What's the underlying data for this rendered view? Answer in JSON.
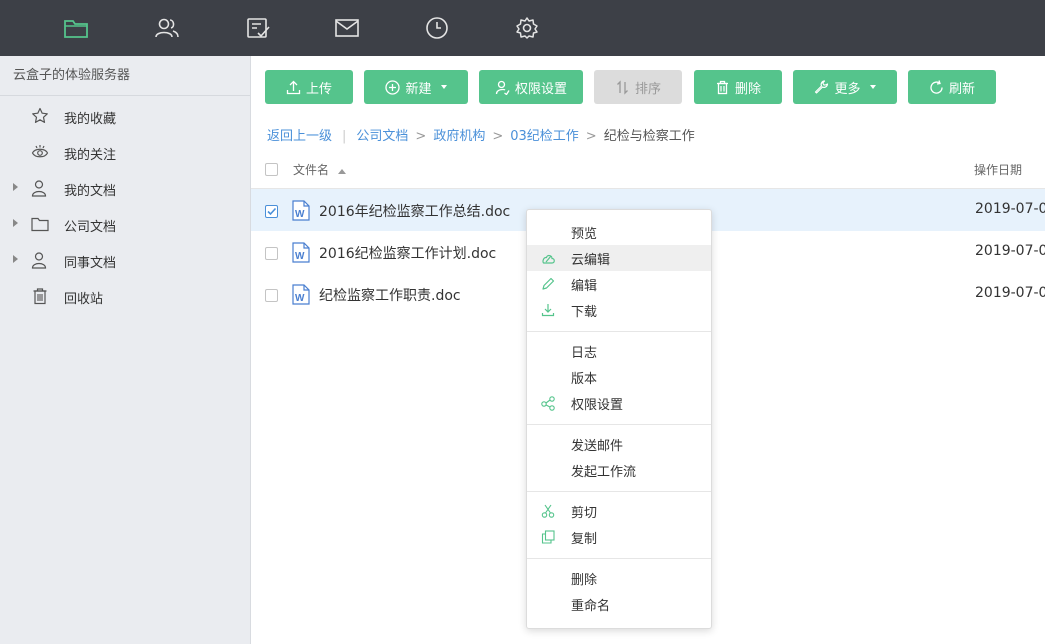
{
  "topbar": {
    "icons": [
      "folder-icon",
      "contacts-icon",
      "tasks-icon",
      "mail-icon",
      "clock-icon",
      "settings-icon"
    ],
    "active_color": "#55c48c"
  },
  "sidebar": {
    "title": "云盒子的体验服务器",
    "items": [
      {
        "label": "我的收藏",
        "icon": "star-icon"
      },
      {
        "label": "我的关注",
        "icon": "eye-icon"
      },
      {
        "label": "我的文档",
        "icon": "user-icon"
      },
      {
        "label": "公司文档",
        "icon": "folder-icon"
      },
      {
        "label": "同事文档",
        "icon": "users-icon"
      },
      {
        "label": "回收站",
        "icon": "trash-icon"
      }
    ]
  },
  "toolbar": {
    "upload": "上传",
    "new": "新建",
    "permissions": "权限设置",
    "sort": "排序",
    "delete": "删除",
    "more": "更多",
    "refresh": "刷新",
    "accent": "#55c48c"
  },
  "breadcrumb": {
    "back": "返回上一级",
    "items": [
      "公司文档",
      "政府机构",
      "03纪检工作"
    ],
    "current": "纪检与检察工作"
  },
  "table": {
    "headers": {
      "name": "文件名",
      "date": "操作日期"
    },
    "rows": [
      {
        "name": "2016年纪检监察工作总结.doc",
        "date": "2019-07-0",
        "checked": true
      },
      {
        "name": "2016纪检监察工作计划.doc",
        "date": "2019-07-0",
        "checked": false
      },
      {
        "name": "纪检监察工作职责.doc",
        "date": "2019-07-0",
        "checked": false
      }
    ]
  },
  "context_menu": {
    "items": [
      {
        "label": "预览",
        "icon": ""
      },
      {
        "label": "云编辑",
        "icon": "cloud-edit-icon"
      },
      {
        "label": "编辑",
        "icon": "pencil-icon"
      },
      {
        "label": "下载",
        "icon": "download-icon"
      },
      {
        "label": "日志",
        "icon": ""
      },
      {
        "label": "版本",
        "icon": ""
      },
      {
        "label": "权限设置",
        "icon": "share-nodes-icon"
      },
      {
        "label": "发送邮件",
        "icon": ""
      },
      {
        "label": "发起工作流",
        "icon": ""
      },
      {
        "label": "剪切",
        "icon": "scissors-icon"
      },
      {
        "label": "复制",
        "icon": "copy-icon"
      },
      {
        "label": "删除",
        "icon": ""
      },
      {
        "label": "重命名",
        "icon": ""
      }
    ]
  }
}
